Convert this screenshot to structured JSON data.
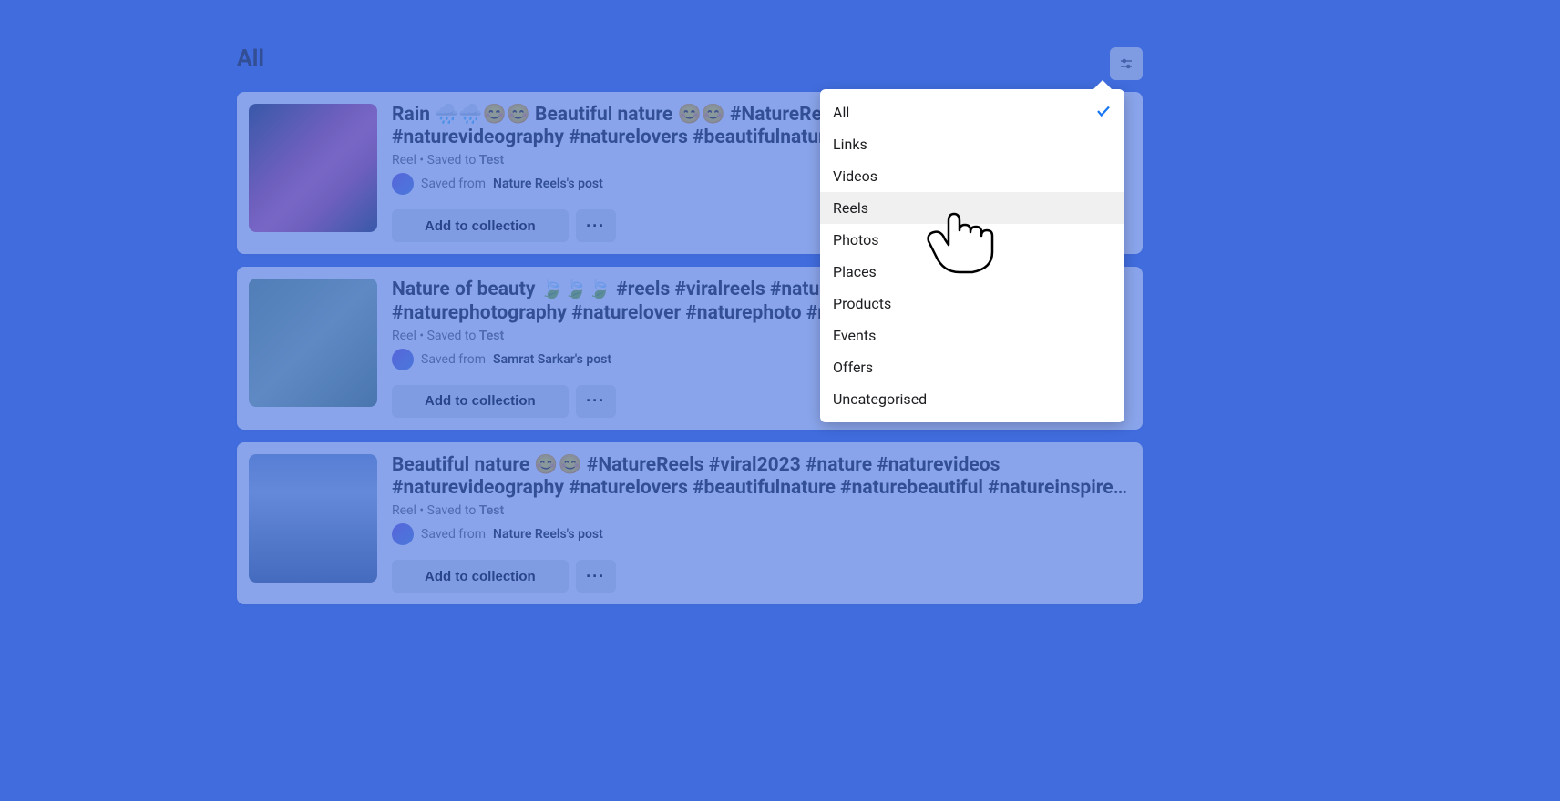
{
  "page_title": "All",
  "add_label": "Add to collection",
  "more_label": "···",
  "items": [
    {
      "title": "Rain 🌧️🌧️😊😊 Beautiful nature 😊😊 #NatureReels #naturelovers #naturevideos #naturevideography #naturelovers #beautifulnature…",
      "meta_type": "Reel",
      "meta_saved": "Saved to",
      "meta_coll": "Test",
      "saved_from_prefix": "Saved from",
      "saved_from_who": "Nature Reels's post"
    },
    {
      "title": "Nature of beauty 🍃🍃🍃 #reels #viralreels #nature #naturephotography #naturephotography #naturelover #naturephoto #naturelovers…",
      "meta_type": "Reel",
      "meta_saved": "Saved to",
      "meta_coll": "Test",
      "saved_from_prefix": "Saved from",
      "saved_from_who": "Samrat Sarkar's post"
    },
    {
      "title": "Beautiful nature 😊😊 #NatureReels #viral2023 #nature #naturevideos #naturevideography #naturelovers #beautifulnature #naturebeautiful #natureinspire…",
      "meta_type": "Reel",
      "meta_saved": "Saved to",
      "meta_coll": "Test",
      "saved_from_prefix": "Saved from",
      "saved_from_who": "Nature Reels's post"
    }
  ],
  "filter_menu": {
    "selected": "All",
    "highlighted": "Reels",
    "options": [
      "All",
      "Links",
      "Videos",
      "Reels",
      "Photos",
      "Places",
      "Products",
      "Events",
      "Offers",
      "Uncategorised"
    ]
  }
}
